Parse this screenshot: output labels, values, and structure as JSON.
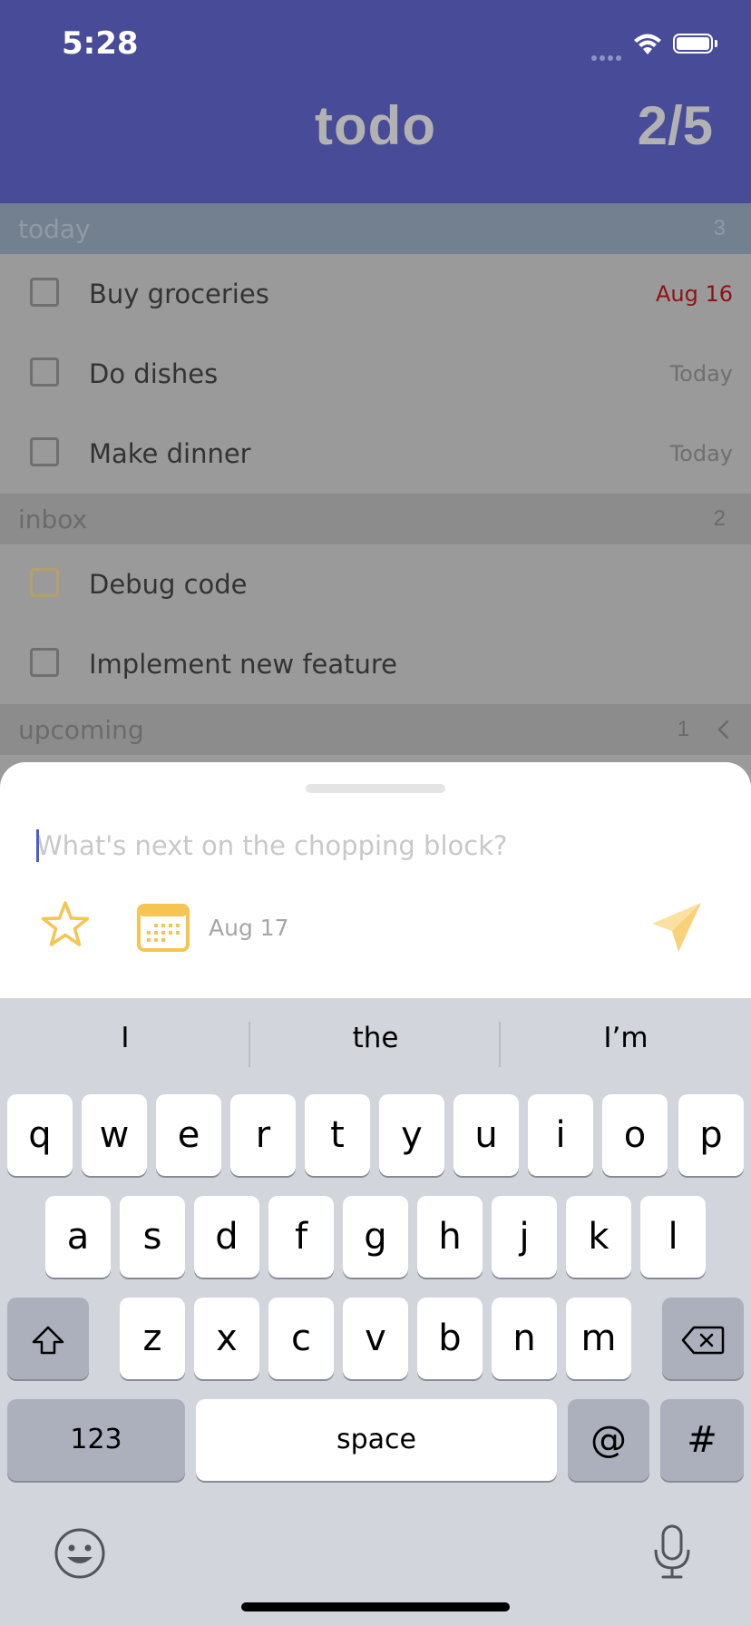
{
  "status_bar": {
    "time": "5:28"
  },
  "header": {
    "title": "todo",
    "progress": "2/5"
  },
  "sections": [
    {
      "title": "today",
      "count": "3"
    },
    {
      "title": "inbox",
      "count": "2"
    },
    {
      "title": "upcoming",
      "count": "1"
    }
  ],
  "tasks": [
    {
      "label": "Buy groceries",
      "date": "Aug 16"
    },
    {
      "label": "Do dishes",
      "date": "Today"
    },
    {
      "label": "Make dinner",
      "date": "Today"
    },
    {
      "label": "Debug code"
    },
    {
      "label": "Implement new feature"
    }
  ],
  "composer": {
    "placeholder": "What's next on the chopping block?",
    "value": "",
    "due_date": "Aug 17"
  },
  "keyboard": {
    "suggestions": [
      "I",
      "the",
      "I’m"
    ],
    "row1": [
      "q",
      "w",
      "e",
      "r",
      "t",
      "y",
      "u",
      "i",
      "o",
      "p"
    ],
    "row2": [
      "a",
      "s",
      "d",
      "f",
      "g",
      "h",
      "j",
      "k",
      "l"
    ],
    "row3": [
      "z",
      "x",
      "c",
      "v",
      "b",
      "n",
      "m"
    ],
    "numbers_label": "123",
    "space_label": "space",
    "at_label": "@",
    "hash_label": "#"
  },
  "colors": {
    "header_bg": "#474b98",
    "accent_yellow": "#f5c451",
    "overdue_red": "#8e1212",
    "cursor_blue": "#4a5ad0"
  },
  "icons": [
    "star-icon",
    "calendar-icon",
    "send-icon",
    "chevron-left-icon",
    "shift-icon",
    "backspace-icon",
    "emoji-icon",
    "microphone-icon",
    "wifi-icon",
    "battery-icon"
  ]
}
